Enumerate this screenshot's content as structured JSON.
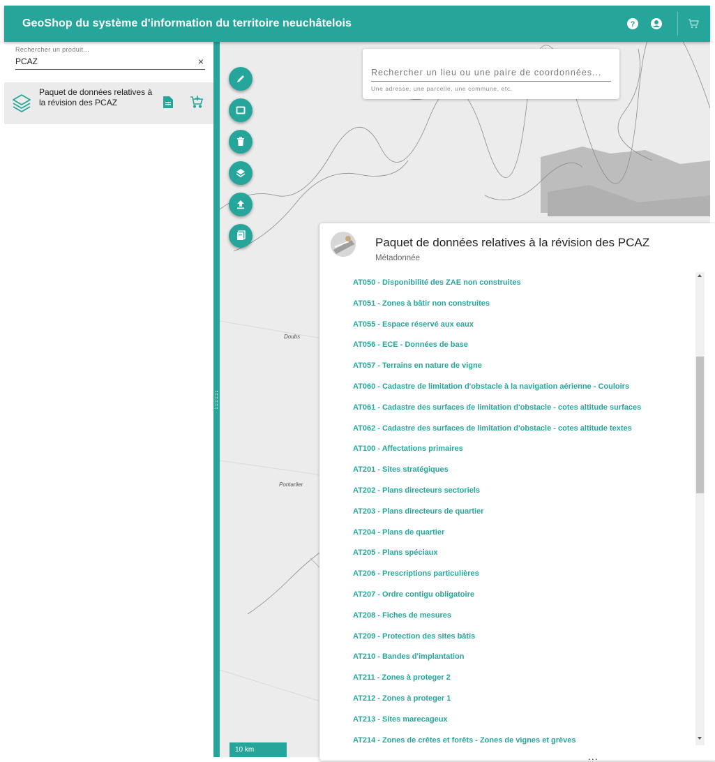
{
  "colors": {
    "accent": "#26a69a",
    "link": "#26a69a"
  },
  "header": {
    "title": "GeoShop du système d'information du territoire neuchâtelois",
    "icons": [
      "help-icon",
      "account-icon",
      "cart-icon"
    ]
  },
  "sidebar": {
    "search_label": "Rechercher un produit...",
    "search_value": "PCAZ",
    "clear_symbol": "×",
    "results": [
      {
        "name": "Paquet de données relatives à la révision des PCAZ",
        "icons": [
          "layers-icon",
          "document-icon",
          "add-to-cart-icon"
        ]
      }
    ]
  },
  "map": {
    "geosearch_placeholder": "Rechercher un lieu ou une paire de coordonnées...",
    "geosearch_hint": "Une adresse, une parcelle, une commune, etc.",
    "tools": [
      "pencil-icon",
      "rectangle-icon",
      "trash-icon",
      "layers-icon",
      "upload-icon",
      "pages-icon"
    ],
    "places": [
      "Doubs",
      "Pontarlier"
    ],
    "scale": "10 km"
  },
  "panel": {
    "title": "Paquet de données relatives à la révision des PCAZ",
    "subtitle": "Métadonnée",
    "items": [
      "AT050 - Disponibilité des ZAE non construites",
      "AT051 - Zones à bâtir non construites",
      "AT055 - Espace réservé aux eaux",
      "AT056 - ECE - Données de base",
      "AT057 - Terrains en nature de vigne",
      "AT060 - Cadastre de limitation d'obstacle à la navigation aérienne - Couloirs",
      "AT061 - Cadastre des surfaces de limitation d'obstacle - cotes altitude surfaces",
      "AT062 - Cadastre des surfaces de limitation d'obstacle - cotes altitude textes",
      "AT100 - Affectations primaires",
      "AT201 - Sites stratégiques",
      "AT202 - Plans directeurs sectoriels",
      "AT203 - Plans directeurs de quartier",
      "AT204 - Plans de quartier",
      "AT205 - Plans spéciaux",
      "AT206 - Prescriptions particulières",
      "AT207 - Ordre contigu obligatoire",
      "AT208 - Fiches de mesures",
      "AT209 - Protection des sites bâtis",
      "AT210 - Bandes d'implantation",
      "AT211 - Zones à proteger 2",
      "AT212 - Zones à proteger 1",
      "AT213 - Sites marecageux",
      "AT214 - Zones de crêtes et forêts - Zones de vignes et grèves"
    ],
    "more": "..."
  }
}
